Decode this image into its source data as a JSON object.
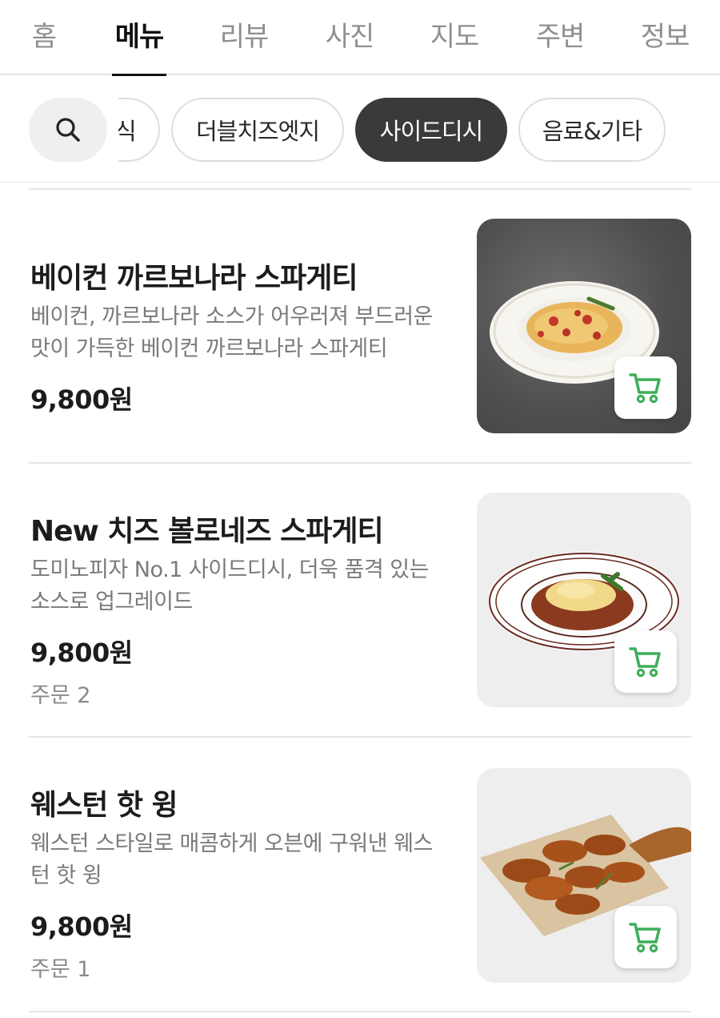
{
  "tabs": [
    {
      "label": "홈",
      "active": false
    },
    {
      "label": "메뉴",
      "active": true
    },
    {
      "label": "리뷰",
      "active": false
    },
    {
      "label": "사진",
      "active": false
    },
    {
      "label": "지도",
      "active": false
    },
    {
      "label": "주변",
      "active": false
    },
    {
      "label": "정보",
      "active": false
    }
  ],
  "chips": [
    {
      "label": "식",
      "active": false
    },
    {
      "label": "더블치즈엣지",
      "active": false
    },
    {
      "label": "사이드디시",
      "active": true
    },
    {
      "label": "음료&기타",
      "active": false
    }
  ],
  "icons": {
    "search": "search-icon",
    "cart": "cart-icon"
  },
  "colors": {
    "accent_cart": "#3fae5a",
    "active_chip": "#3a3a3a"
  },
  "menu_items": [
    {
      "name": "베이컨 까르보나라 스파게티",
      "desc": "베이컨, 까르보나라 소스가 어우러져 부드러운 맛이 가득한 베이컨 까르보나라 스파게티",
      "price": "9,800원",
      "orders": ""
    },
    {
      "name": "New 치즈 볼로네즈 스파게티",
      "desc": "도미노피자 No.1 사이드디시, 더욱 품격 있는 소스로 업그레이드",
      "price": "9,800원",
      "orders": "주문 2"
    },
    {
      "name": "웨스턴 핫 윙",
      "desc": "웨스턴 스타일로 매콤하게 오븐에 구워낸 웨스턴 핫 윙",
      "price": "9,800원",
      "orders": "주문 1"
    }
  ]
}
